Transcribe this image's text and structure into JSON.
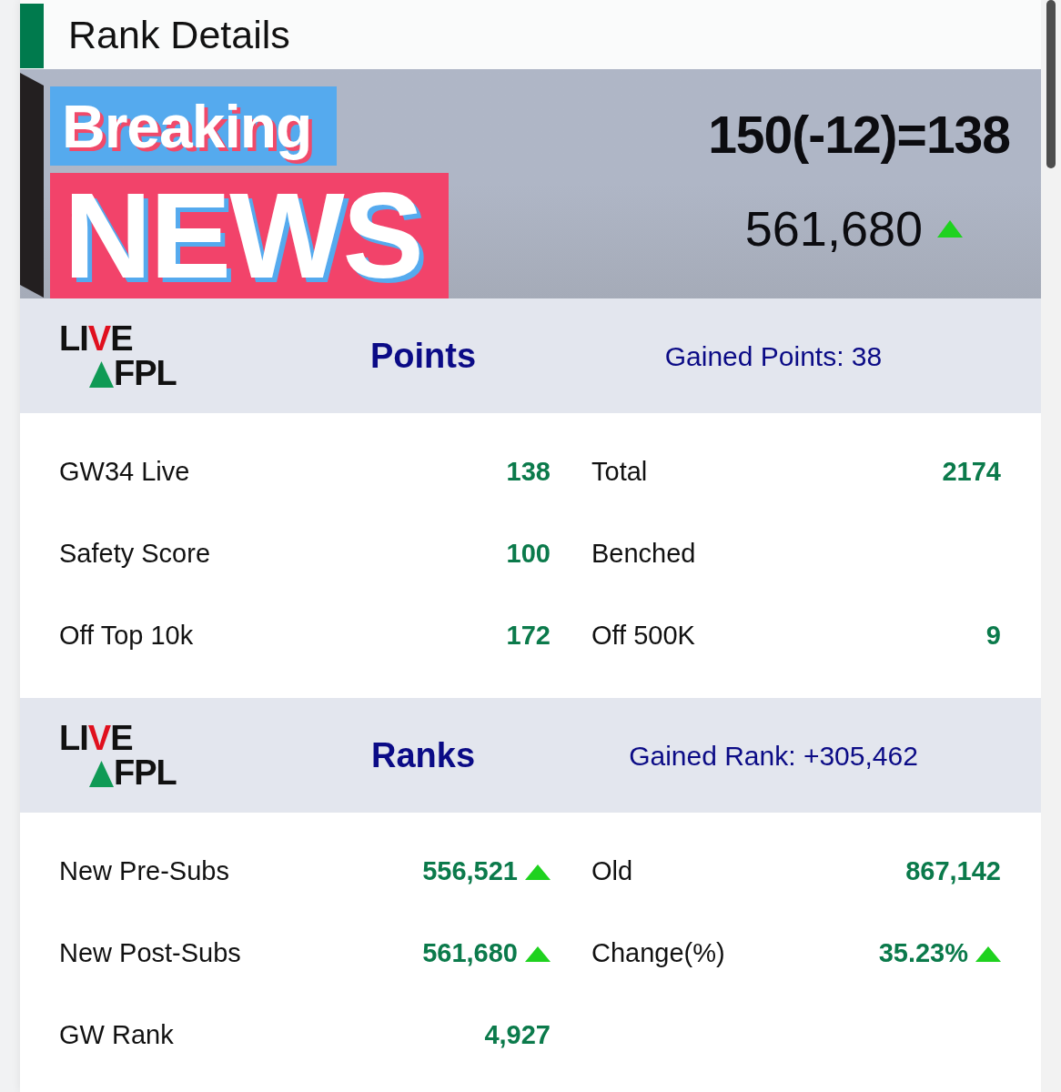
{
  "page": {
    "title": "Rank Details"
  },
  "banner": {
    "sticker": {
      "top_word": "Breaking",
      "bottom_word": "NEWS"
    },
    "score": "150(-12)=138",
    "rank": {
      "value": "561,680",
      "rising": true
    }
  },
  "sections": [
    {
      "logo": {
        "line_1": "LIVE",
        "line_2": "FPL"
      },
      "title": "Points",
      "summary": "Gained Points: 38",
      "rows": [
        {
          "cells": [
            {
              "label": "GW34 Live",
              "value": "138"
            },
            {
              "label": "Total",
              "value": "2174"
            }
          ]
        },
        {
          "cells": [
            {
              "label": "Safety Score",
              "value": "100"
            },
            {
              "label": "Benched"
            }
          ]
        },
        {
          "cells": [
            {
              "label": "Off Top 10k",
              "value": "172"
            },
            {
              "label": "Off 500K",
              "value": "9"
            }
          ]
        }
      ]
    },
    {
      "logo": {
        "line_1": "LIVE",
        "line_2": "FPL"
      },
      "title": "Ranks",
      "summary": "Gained Rank: +305,462",
      "rows": [
        {
          "cells": [
            {
              "label": "New Pre-Subs",
              "value": "556,521",
              "rising": true
            },
            {
              "label": "Old",
              "value": "867,142"
            }
          ]
        },
        {
          "cells": [
            {
              "label": "New Post-Subs",
              "value": "561,680",
              "rising": true
            },
            {
              "label": "Change(%)",
              "value": "35.23%",
              "rising": true
            }
          ]
        },
        {
          "cells": [
            {
              "label": "GW Rank",
              "value": "4,927"
            }
          ]
        }
      ]
    }
  ]
}
